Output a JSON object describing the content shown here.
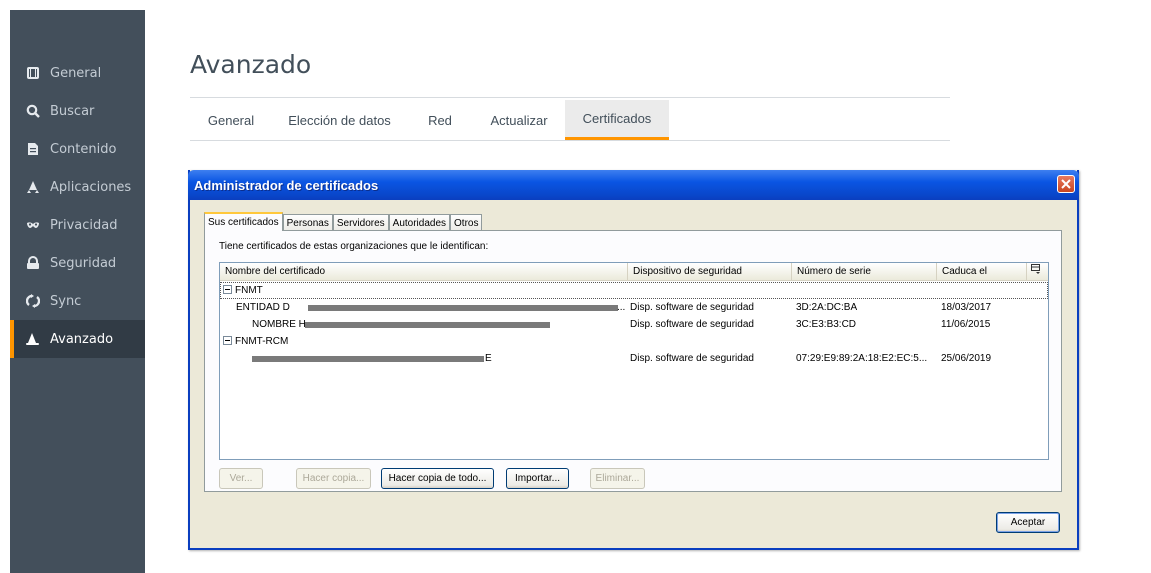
{
  "sidebar": {
    "items": [
      {
        "label": "General",
        "icon": "general-icon"
      },
      {
        "label": "Buscar",
        "icon": "search-icon"
      },
      {
        "label": "Contenido",
        "icon": "document-icon"
      },
      {
        "label": "Aplicaciones",
        "icon": "rocket-icon"
      },
      {
        "label": "Privacidad",
        "icon": "mask-icon"
      },
      {
        "label": "Seguridad",
        "icon": "lock-icon"
      },
      {
        "label": "Sync",
        "icon": "sync-icon"
      },
      {
        "label": "Avanzado",
        "icon": "wizard-hat-icon",
        "active": true
      }
    ]
  },
  "page": {
    "title": "Avanzado",
    "tabs": [
      {
        "label": "General"
      },
      {
        "label": "Elección de datos"
      },
      {
        "label": "Red"
      },
      {
        "label": "Actualizar"
      },
      {
        "label": "Certificados",
        "active": true
      }
    ]
  },
  "dialog": {
    "title": "Administrador de certificados",
    "tabs": [
      {
        "label": "Sus certificados",
        "active": true
      },
      {
        "label": "Personas"
      },
      {
        "label": "Servidores"
      },
      {
        "label": "Autoridades"
      },
      {
        "label": "Otros"
      }
    ],
    "description": "Tiene certificados de estas organizaciones que le identifican:",
    "columns": [
      "Nombre del certificado",
      "Dispositivo de seguridad",
      "Número de serie",
      "Caduca el"
    ],
    "groups": [
      {
        "name": "FNMT",
        "rows": [
          {
            "name": "ENTIDAD D",
            "device": "Disp. software de seguridad",
            "serial": "3D:2A:DC:BA",
            "expires": "18/03/2017",
            "lead": "..."
          },
          {
            "name": "NOMBRE H",
            "device": "Disp. software de seguridad",
            "serial": "3C:E3:B3:CD",
            "expires": "11/06/2015"
          }
        ]
      },
      {
        "name": "FNMT-RCM",
        "rows": [
          {
            "name_suffix": "E",
            "device": "Disp. software de seguridad",
            "serial": "07:29:E9:89:2A:18:E2:EC:5...",
            "expires": "25/06/2019"
          }
        ]
      }
    ],
    "buttons": {
      "view": "Ver...",
      "backup": "Hacer copia...",
      "backup_all": "Hacer copia de todo...",
      "import": "Importar...",
      "delete": "Eliminar...",
      "ok": "Aceptar"
    }
  }
}
